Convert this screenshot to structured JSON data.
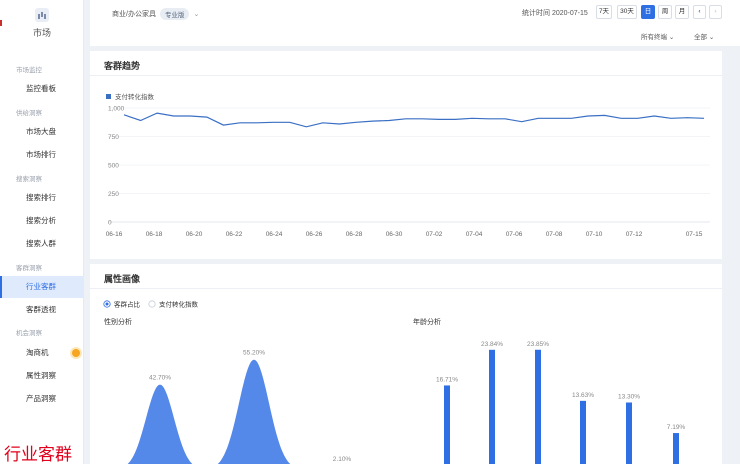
{
  "sidebar": {
    "logo_label": "市场",
    "groups": [
      {
        "label": "市场监控",
        "items": [
          {
            "label": "监控看板"
          }
        ]
      },
      {
        "label": "供给洞察",
        "items": [
          {
            "label": "市场大盘"
          },
          {
            "label": "市场排行"
          }
        ]
      },
      {
        "label": "搜索洞察",
        "items": [
          {
            "label": "搜索排行"
          },
          {
            "label": "搜索分析"
          },
          {
            "label": "搜索人群"
          }
        ]
      },
      {
        "label": "客群洞察",
        "items": [
          {
            "label": "行业客群"
          },
          {
            "label": "客群透视"
          }
        ]
      },
      {
        "label": "机会洞察",
        "items": [
          {
            "label": "淘商机"
          },
          {
            "label": "属性洞察"
          },
          {
            "label": "产品洞察"
          }
        ]
      }
    ],
    "active_item": "行业客群"
  },
  "overlay_caption": "行业客群",
  "topbar": {
    "category": "商业/办公家具",
    "edition_tag": "专业版",
    "stat_time_label": "统计时间 2020-07-15",
    "period_buttons": [
      "7天",
      "30天",
      "日",
      "周",
      "月"
    ],
    "active_period": "日",
    "prev_label": "‹",
    "next_label": "›",
    "filter_terminal": "所有终端",
    "filter_all": "全部"
  },
  "trend_card": {
    "title": "客群趋势",
    "legend": "支付转化指数",
    "series_color": "#3a6fc4"
  },
  "attr_card": {
    "title": "属性画像",
    "radio_options": [
      "客群占比",
      "支付转化指数"
    ],
    "selected_radio": "客群占比",
    "gender_title": "性别分析",
    "age_title": "年龄分析",
    "accent_color": "#2f6fe4"
  },
  "chart_data": [
    {
      "type": "line",
      "series": [
        {
          "name": "支付转化指数",
          "values": [
            940,
            890,
            955,
            930,
            930,
            920,
            850,
            870,
            870,
            875,
            875,
            835,
            870,
            860,
            875,
            885,
            890,
            905,
            905,
            900,
            900,
            910,
            905,
            905,
            880,
            910,
            910,
            910,
            930,
            935,
            910,
            910,
            930,
            910,
            915,
            910
          ]
        }
      ],
      "x_tick_labels": [
        "06-16",
        "06-18",
        "06-20",
        "06-22",
        "06-24",
        "06-26",
        "06-28",
        "06-30",
        "07-02",
        "07-04",
        "07-06",
        "07-08",
        "07-10",
        "07-12",
        "07-15"
      ],
      "y_tick_labels": [
        "1,000",
        "750",
        "500",
        "250",
        "0"
      ],
      "ylim": [
        0,
        1000
      ],
      "grid": true,
      "legend": "top-left"
    },
    {
      "type": "area",
      "title": "性别分析",
      "series": [
        {
          "value": 42.7,
          "label": "42.70%"
        },
        {
          "value": 55.2,
          "label": "55.20%"
        },
        {
          "value": 2.1,
          "label": "2.10%"
        }
      ]
    },
    {
      "type": "bar",
      "title": "年龄分析",
      "series": [
        {
          "value": 16.71,
          "label": "16.71%"
        },
        {
          "value": 23.84,
          "label": "23.84%"
        },
        {
          "value": 23.85,
          "label": "23.85%"
        },
        {
          "value": 13.63,
          "label": "13.63%"
        },
        {
          "value": 13.3,
          "label": "13.30%"
        },
        {
          "value": 7.19,
          "label": "7.19%"
        }
      ]
    }
  ]
}
